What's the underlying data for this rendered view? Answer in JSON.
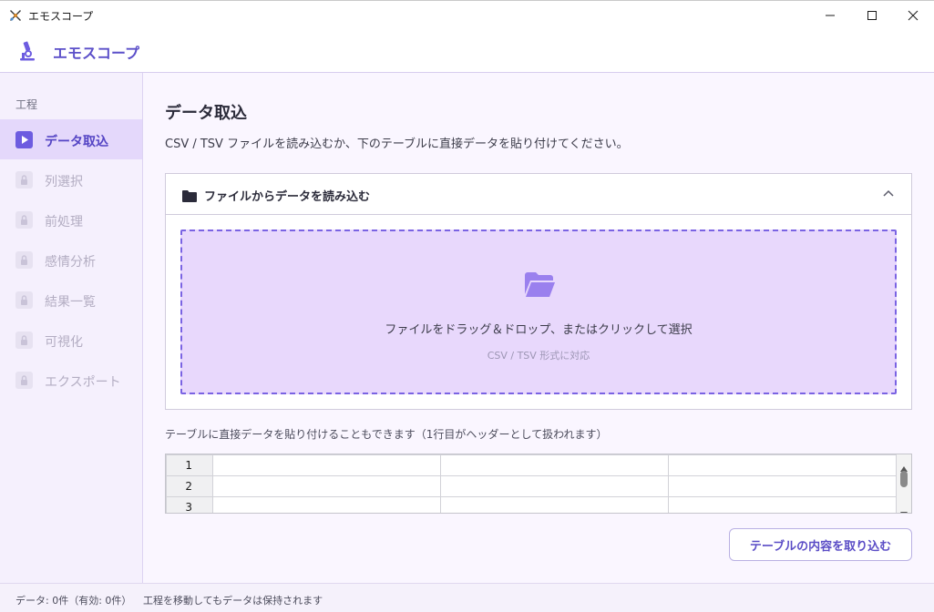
{
  "window": {
    "title": "エモスコープ",
    "icon": "app-emblem-icon",
    "controls": [
      "minimize-icon",
      "maximize-icon",
      "close-icon"
    ]
  },
  "header": {
    "app_name": "エモスコープ",
    "logo_icon": "microscope-icon"
  },
  "sidebar": {
    "section_label": "工程",
    "items": [
      {
        "label": "データ取込",
        "state": "active",
        "icon": "play-icon"
      },
      {
        "label": "列選択",
        "state": "locked",
        "icon": "lock-icon"
      },
      {
        "label": "前処理",
        "state": "locked",
        "icon": "lock-icon"
      },
      {
        "label": "感情分析",
        "state": "locked",
        "icon": "lock-icon"
      },
      {
        "label": "結果一覧",
        "state": "locked",
        "icon": "lock-icon"
      },
      {
        "label": "可視化",
        "state": "locked",
        "icon": "lock-icon"
      },
      {
        "label": "エクスポート",
        "state": "locked",
        "icon": "lock-icon"
      }
    ]
  },
  "main": {
    "title": "データ取込",
    "description": "CSV / TSV ファイルを読み込むか、下のテーブルに直接データを貼り付けてください。",
    "file_panel": {
      "title": "ファイルからデータを読み込む",
      "expanded": true,
      "dropzone_text": "ファイルをドラッグ＆ドロップ、またはクリックして選択",
      "dropzone_subtext": "CSV / TSV 形式に対応"
    },
    "paste_hint": "テーブルに直接データを貼り付けることもできます（1行目がヘッダーとして扱われます）",
    "table": {
      "row_headers": [
        "1",
        "2",
        "3"
      ],
      "rows": [
        [
          "",
          "",
          ""
        ],
        [
          "",
          "",
          ""
        ],
        [
          "",
          "",
          ""
        ]
      ]
    },
    "import_button": "テーブルの内容を取り込む"
  },
  "status": {
    "data_count": "データ: 0件（有効: 0件）",
    "message": "工程を移動してもデータは保持されます"
  },
  "colors": {
    "accent": "#6d5ce0",
    "accent_text": "#5444c4",
    "sidebar_bg": "#f5f0fd",
    "active_bg": "#e4d8fb",
    "dropzone_bg": "#e8d8fc",
    "dropzone_border": "#7a63e3"
  }
}
